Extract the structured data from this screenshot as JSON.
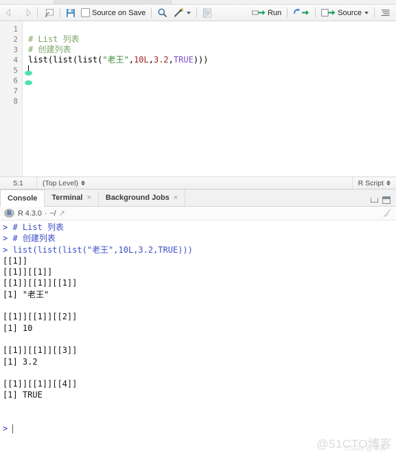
{
  "editor_toolbar": {
    "back_icon": "back-arrow-icon",
    "forward_icon": "forward-arrow-icon",
    "show_doc_outline_icon": "show-in-new-window-icon",
    "save_icon": "save-icon",
    "source_on_save_label": "Source on Save",
    "find_icon": "magnifier-icon",
    "code_tools_icon": "magic-wand-icon",
    "compile_report_icon": "notebook-icon",
    "run_label": "Run",
    "rerun_icon": "rerun-previous-icon",
    "source_label": "Source",
    "outline_icon": "document-outline-icon"
  },
  "editor": {
    "line_numbers": [
      "1",
      "2",
      "3",
      "4",
      "5",
      "6",
      "7",
      "8"
    ],
    "lines": [
      {
        "num": "1",
        "tokens": []
      },
      {
        "num": "2",
        "tokens": [
          {
            "t": "# List 列表",
            "c": "tok-comment"
          }
        ]
      },
      {
        "num": "3",
        "tokens": [
          {
            "t": "# 创建列表",
            "c": "tok-comment"
          }
        ]
      },
      {
        "num": "4",
        "tokens": [
          {
            "t": "list(list(list(",
            "c": "tok-fn"
          },
          {
            "t": "\"老王\"",
            "c": "tok-str"
          },
          {
            "t": ",",
            "c": "tok-fn"
          },
          {
            "t": "10L",
            "c": "tok-num"
          },
          {
            "t": ",",
            "c": "tok-fn"
          },
          {
            "t": "3.2",
            "c": "tok-num"
          },
          {
            "t": ",",
            "c": "tok-fn"
          },
          {
            "t": "TRUE",
            "c": "tok-const"
          },
          {
            "t": ")))",
            "c": "tok-fn"
          }
        ]
      },
      {
        "num": "5",
        "tokens": []
      },
      {
        "num": "6",
        "tokens": []
      },
      {
        "num": "7",
        "tokens": []
      },
      {
        "num": "8",
        "tokens": []
      }
    ]
  },
  "editor_status": {
    "cursor_position": "5:1",
    "scope": "(Top Level)",
    "file_type": "R Script"
  },
  "console_tabs": [
    {
      "label": "Console",
      "closable": false,
      "active": true
    },
    {
      "label": "Terminal",
      "closable": true,
      "active": false
    },
    {
      "label": "Background Jobs",
      "closable": true,
      "active": false
    }
  ],
  "console_header": {
    "r_logo": "R",
    "version": "R 4.3.0",
    "separator": "·",
    "working_dir": "~/",
    "open_dir_icon": "open-directory-icon",
    "clear_console_icon": "broom-icon"
  },
  "console_output": [
    {
      "text": "> # List 列表",
      "cls": "c-input"
    },
    {
      "text": "> # 创建列表",
      "cls": "c-input"
    },
    {
      "text": "> list(list(list(\"老王\",10L,3.2,TRUE)))",
      "cls": "c-input"
    },
    {
      "text": "[[1]]",
      "cls": "c-out"
    },
    {
      "text": "[[1]][[1]]",
      "cls": "c-out"
    },
    {
      "text": "[[1]][[1]][[1]]",
      "cls": "c-out"
    },
    {
      "text": "[1] \"老王\"",
      "cls": "c-out"
    },
    {
      "text": "",
      "cls": "c-out"
    },
    {
      "text": "[[1]][[1]][[2]]",
      "cls": "c-out"
    },
    {
      "text": "[1] 10",
      "cls": "c-out"
    },
    {
      "text": "",
      "cls": "c-out"
    },
    {
      "text": "[[1]][[1]][[3]]",
      "cls": "c-out"
    },
    {
      "text": "[1] 3.2",
      "cls": "c-out"
    },
    {
      "text": "",
      "cls": "c-out"
    },
    {
      "text": "[[1]][[1]][[4]]",
      "cls": "c-out"
    },
    {
      "text": "[1] TRUE",
      "cls": "c-out"
    },
    {
      "text": "",
      "cls": "c-out"
    },
    {
      "text": "",
      "cls": "c-out"
    }
  ],
  "console_prompt": {
    "symbol": ">"
  },
  "watermark": {
    "primary": "@51CTO博客",
    "secondary": "CSDN @博客"
  },
  "colors": {
    "accent_blue": "#3b4ec9",
    "comment_green": "#7fa56b",
    "string_green": "#3e8e41",
    "number_red": "#a0231f",
    "const_purple": "#7a52c7",
    "fold_marker": "#4fe0b5"
  }
}
